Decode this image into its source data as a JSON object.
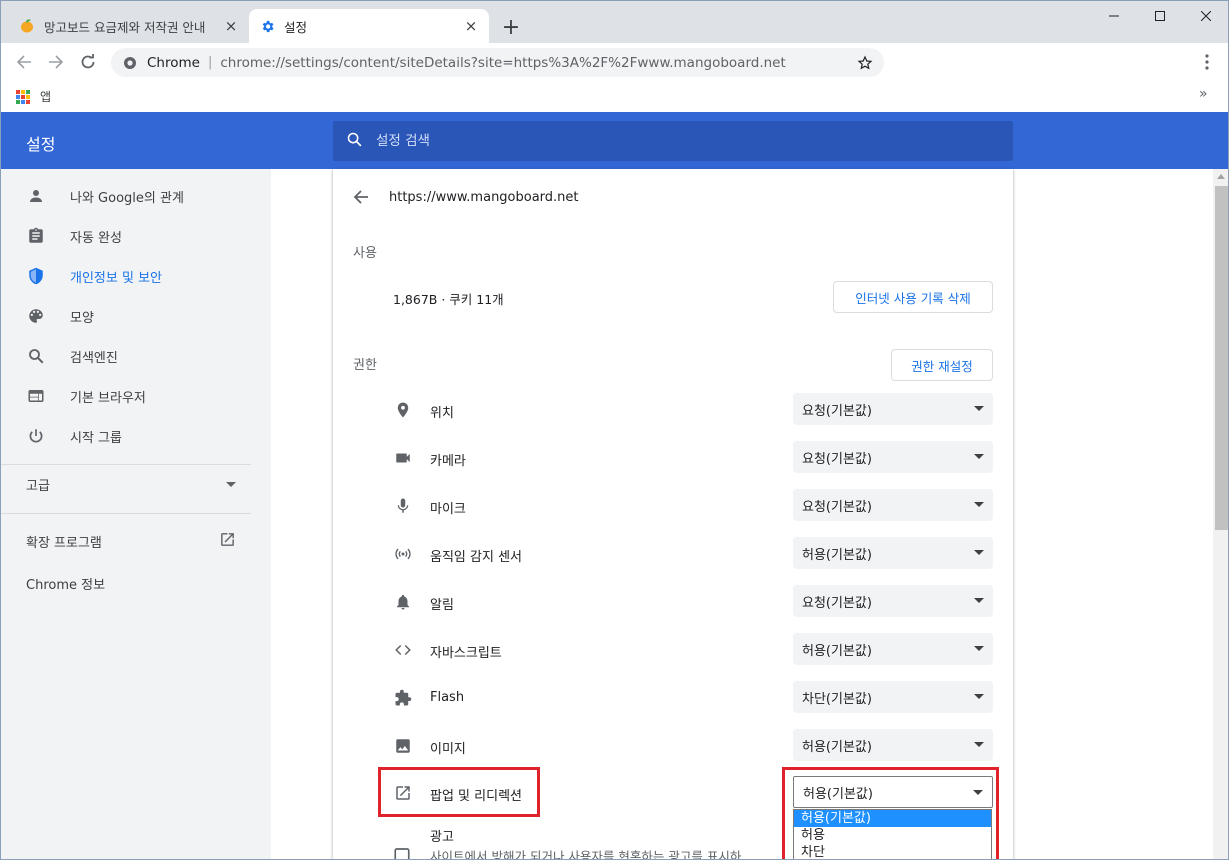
{
  "tabs": [
    {
      "title": "망고보드 요금제와 저작권 안내",
      "favicon": "mango-icon",
      "close": "×"
    },
    {
      "title": "설정",
      "favicon": "gear-icon",
      "close": "×"
    }
  ],
  "new_tab": "+",
  "omnibox": {
    "scheme": "Chrome",
    "separator": "|",
    "url": "chrome://settings/content/siteDetails?site=https%3A%2F%2Fwww.mangoboard.net"
  },
  "bookmarks": {
    "apps_label": "앱",
    "more": "»"
  },
  "header": {
    "title": "설정",
    "search_placeholder": "설정 검색"
  },
  "sidebar": {
    "items": [
      {
        "label": "나와 Google의 관계",
        "icon": "person-icon"
      },
      {
        "label": "자동 완성",
        "icon": "clipboard-icon"
      },
      {
        "label": "개인정보 및 보안",
        "icon": "shield-icon"
      },
      {
        "label": "모양",
        "icon": "palette-icon"
      },
      {
        "label": "검색엔진",
        "icon": "search-icon"
      },
      {
        "label": "기본 브라우저",
        "icon": "browser-icon"
      },
      {
        "label": "시작 그룹",
        "icon": "power-icon"
      }
    ],
    "selected_index": 2,
    "advanced_label": "고급",
    "extensions_label": "확장 프로그램",
    "about_label": "Chrome 정보"
  },
  "main": {
    "origin": "https://www.mangoboard.net",
    "usage_section": "사용",
    "usage_text": "1,867B · 쿠키 11개",
    "clear_button": "인터넷 사용 기록 삭제",
    "permissions_section": "권한",
    "reset_button": "권한 재설정",
    "permissions": [
      {
        "label": "위치",
        "value": "요청(기본값)",
        "icon": "location-icon"
      },
      {
        "label": "카메라",
        "value": "요청(기본값)",
        "icon": "camera-icon"
      },
      {
        "label": "마이크",
        "value": "요청(기본값)",
        "icon": "mic-icon"
      },
      {
        "label": "움직임 감지 센서",
        "value": "허용(기본값)",
        "icon": "sensor-icon"
      },
      {
        "label": "알림",
        "value": "요청(기본값)",
        "icon": "bell-icon"
      },
      {
        "label": "자바스크립트",
        "value": "허용(기본값)",
        "icon": "code-icon"
      },
      {
        "label": "Flash",
        "value": "차단(기본값)",
        "icon": "puzzle-icon"
      },
      {
        "label": "이미지",
        "value": "허용(기본값)",
        "icon": "image-icon"
      },
      {
        "label": "팝업 및 리디렉션",
        "value": "허용(기본값)",
        "icon": "open-in-new-icon"
      }
    ],
    "ads_title": "광고",
    "ads_desc": "사이트에서 방해가 되거나 사용자를 현혹하는 광고를 표시하",
    "dropdown_options": [
      "허용(기본값)",
      "허용",
      "차단"
    ]
  },
  "colors": {
    "header": "#3367d6",
    "accent": "#1a73e8",
    "highlight": "#e0232b"
  }
}
